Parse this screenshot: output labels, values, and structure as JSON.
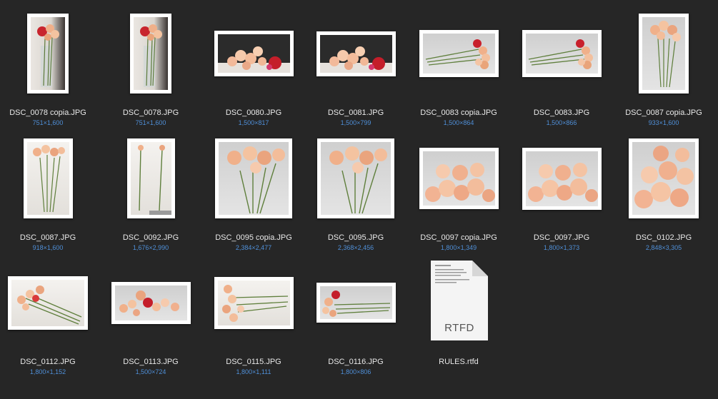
{
  "files": [
    {
      "name": "DSC_0078 copia.JPG",
      "dims": "751×1,600",
      "icon": "photo-icon"
    },
    {
      "name": "DSC_0078.JPG",
      "dims": "751×1,600",
      "icon": "photo-icon"
    },
    {
      "name": "DSC_0080.JPG",
      "dims": "1,500×817",
      "icon": "photo-icon"
    },
    {
      "name": "DSC_0081.JPG",
      "dims": "1,500×799",
      "icon": "photo-icon"
    },
    {
      "name": "DSC_0083 copia.JPG",
      "dims": "1,500×864",
      "icon": "photo-icon"
    },
    {
      "name": "DSC_0083.JPG",
      "dims": "1,500×866",
      "icon": "photo-icon"
    },
    {
      "name": "DSC_0087 copia.JPG",
      "dims": "933×1,600",
      "icon": "photo-icon"
    },
    {
      "name": "DSC_0087.JPG",
      "dims": "918×1,600",
      "icon": "photo-icon"
    },
    {
      "name": "DSC_0092.JPG",
      "dims": "1,676×2,990",
      "icon": "photo-icon"
    },
    {
      "name": "DSC_0095 copia.JPG",
      "dims": "2,384×2,477",
      "icon": "photo-icon"
    },
    {
      "name": "DSC_0095.JPG",
      "dims": "2,368×2,456",
      "icon": "photo-icon"
    },
    {
      "name": "DSC_0097 copia.JPG",
      "dims": "1,800×1,349",
      "icon": "photo-icon"
    },
    {
      "name": "DSC_0097.JPG",
      "dims": "1,800×1,373",
      "icon": "photo-icon"
    },
    {
      "name": "DSC_0102.JPG",
      "dims": "2,848×3,305",
      "icon": "photo-icon"
    },
    {
      "name": "DSC_0112.JPG",
      "dims": "1,800×1,152",
      "icon": "photo-icon"
    },
    {
      "name": "DSC_0113.JPG",
      "dims": "1,500×724",
      "icon": "photo-icon"
    },
    {
      "name": "DSC_0115.JPG",
      "dims": "1,800×1,111",
      "icon": "photo-icon"
    },
    {
      "name": "DSC_0116.JPG",
      "dims": "1,800×806",
      "icon": "photo-icon"
    },
    {
      "name": "RULES.rtfd",
      "dims": "",
      "icon": "rtfd-document-icon",
      "doc_label": "RTFD"
    }
  ],
  "colors": {
    "background": "#262626",
    "filename_text": "#e8e8e8",
    "dimension_text": "#4f8fd8"
  }
}
